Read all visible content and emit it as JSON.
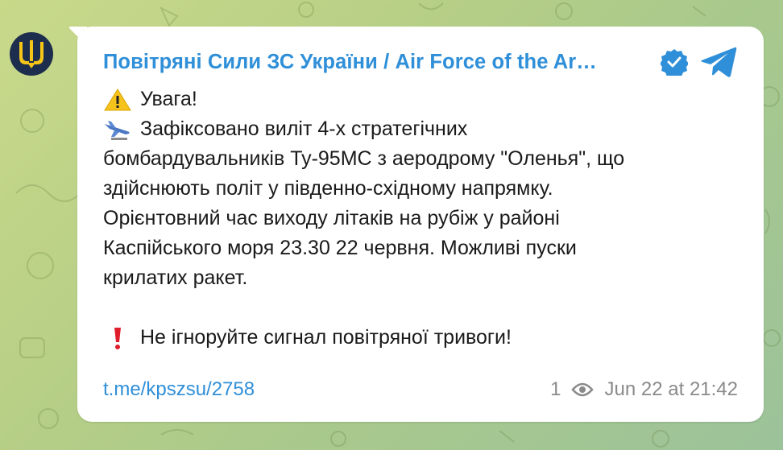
{
  "channel": {
    "name": "Повітряні Сили ЗС України / Air Force of the Ar…",
    "avatar_icon": "trident-icon",
    "verified_icon": "verified-badge-icon",
    "app_icon": "telegram-icon"
  },
  "message": {
    "lines": [
      "Увага!",
      "Зафіксовано виліт 4-х стратегічних",
      "бомбардувальників Ту-95МС з аеродрому \"Оленья\", що",
      "здійснюють політ у південно-східному напрямку.",
      "Орієнтовний час виходу літаків на рубіж у районі",
      "Каспійського моря 23.30 22 червня. Можливі пуски",
      "крилатих ракет.",
      "Не ігноруйте сигнал повітряної тривоги!"
    ],
    "emoji_icons": [
      "warning-icon",
      "airplane-icon",
      "exclamation-icon"
    ]
  },
  "footer": {
    "link": "t.me/kpszsu/2758",
    "views": "1",
    "time": "Jun 22 at 21:42"
  },
  "colors": {
    "accent": "#2f8fd8",
    "background": "#b7cf86",
    "avatar": "#1d2d4d",
    "trident": "#f5c518"
  }
}
